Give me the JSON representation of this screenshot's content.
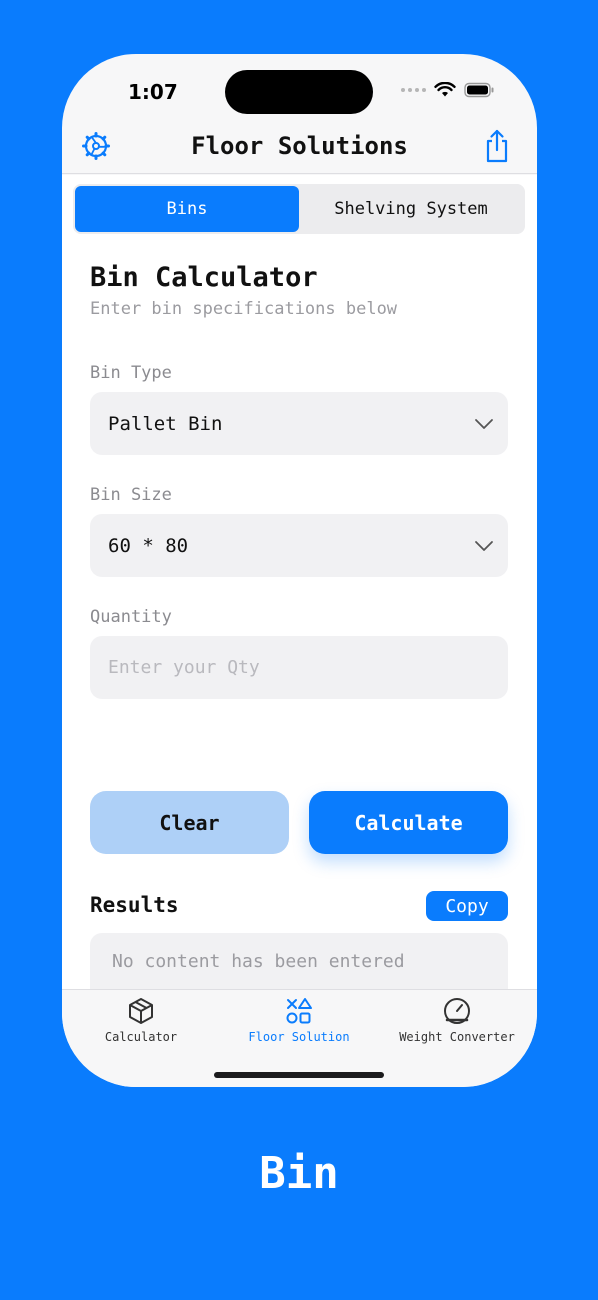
{
  "status": {
    "time": "1:07"
  },
  "nav": {
    "title": "Floor Solutions",
    "settings_icon": "gear-icon",
    "share_icon": "share-icon"
  },
  "segments": [
    {
      "label": "Bins",
      "active": true
    },
    {
      "label": "Shelving System",
      "active": false
    }
  ],
  "form": {
    "title": "Bin Calculator",
    "subtitle": "Enter bin specifications below",
    "bin_type": {
      "label": "Bin Type",
      "value": "Pallet Bin"
    },
    "bin_size": {
      "label": "Bin Size",
      "value": "60 * 80"
    },
    "quantity": {
      "label": "Quantity",
      "placeholder": "Enter your Qty",
      "value": ""
    },
    "clear_label": "Clear",
    "calculate_label": "Calculate"
  },
  "results": {
    "label": "Results",
    "copy_label": "Copy",
    "placeholder": "No content has been entered"
  },
  "tabs": [
    {
      "label": "Calculator",
      "icon": "box-icon",
      "active": false
    },
    {
      "label": "Floor Solution",
      "icon": "shapes-icon",
      "active": true
    },
    {
      "label": "Weight Converter",
      "icon": "scale-icon",
      "active": false
    }
  ],
  "caption": "Bin",
  "colors": {
    "accent": "#0a7cfd",
    "clear_button": "#aed0f7"
  }
}
